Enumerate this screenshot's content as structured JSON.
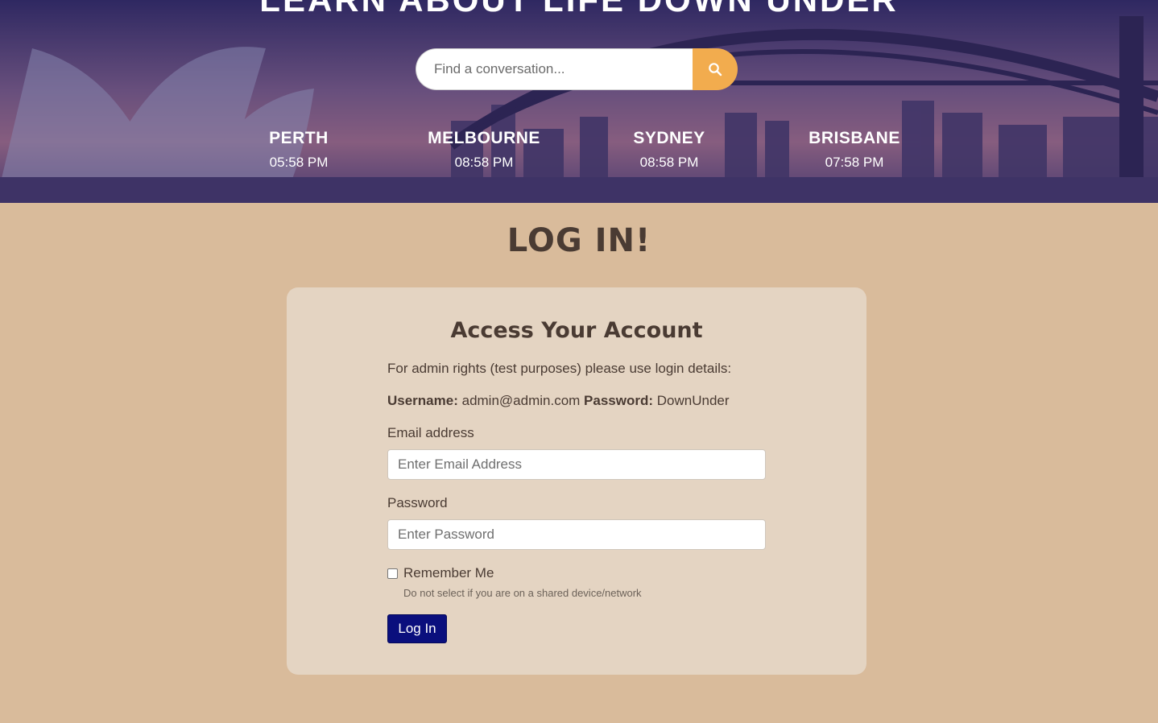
{
  "hero": {
    "title": "LEARN ABOUT LIFE DOWN UNDER",
    "search": {
      "placeholder": "Find a conversation...",
      "button_icon": "search-icon"
    },
    "cities": [
      {
        "name": "PERTH",
        "time": "05:58 PM"
      },
      {
        "name": "MELBOURNE",
        "time": "08:58 PM"
      },
      {
        "name": "SYDNEY",
        "time": "08:58 PM"
      },
      {
        "name": "BRISBANE",
        "time": "07:58 PM"
      }
    ]
  },
  "main": {
    "heading": "LOG IN!",
    "card": {
      "title": "Access Your Account",
      "note": "For admin rights (test purposes) please use login details:",
      "username_label": "Username:",
      "username_value": "admin@admin.com",
      "password_label": "Password:",
      "password_value": "DownUnder",
      "email_label": "Email address",
      "email_placeholder": "Enter Email Address",
      "password_field_label": "Password",
      "password_placeholder": "Enter Password",
      "remember_label": "Remember Me",
      "remember_hint": "Do not select if you are on a shared device/network",
      "submit_label": "Log In"
    }
  },
  "colors": {
    "page_bg": "#d9bb9b",
    "card_bg": "#e4d4c2",
    "search_button": "#f2ac4e",
    "login_button": "#0a0f7d",
    "text": "#4a3b33"
  }
}
